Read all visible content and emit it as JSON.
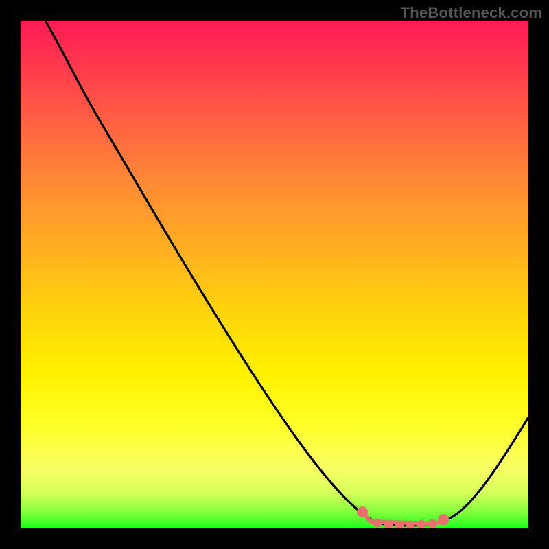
{
  "watermark": "TheBottleneck.com",
  "colors": {
    "background": "#000000",
    "gradient_top": "#ff1a55",
    "gradient_mid": "#ffd60a",
    "gradient_bottom": "#1aff1a",
    "curve": "#000000",
    "marker": "#e9706e"
  },
  "chart_data": {
    "type": "line",
    "title": "",
    "xlabel": "",
    "ylabel": "",
    "xlim": [
      0,
      100
    ],
    "ylim": [
      0,
      100
    ],
    "x": [
      0,
      6,
      12,
      18,
      24,
      30,
      36,
      42,
      48,
      54,
      60,
      64,
      68,
      72,
      76,
      80,
      84,
      88,
      92,
      96,
      100
    ],
    "values": [
      100,
      94,
      87,
      79,
      71,
      63,
      55,
      47,
      39,
      31,
      23,
      16,
      9,
      4,
      1,
      0,
      0,
      3,
      9,
      17,
      27
    ],
    "highlight_range_x": [
      68,
      86
    ],
    "annotations": []
  }
}
